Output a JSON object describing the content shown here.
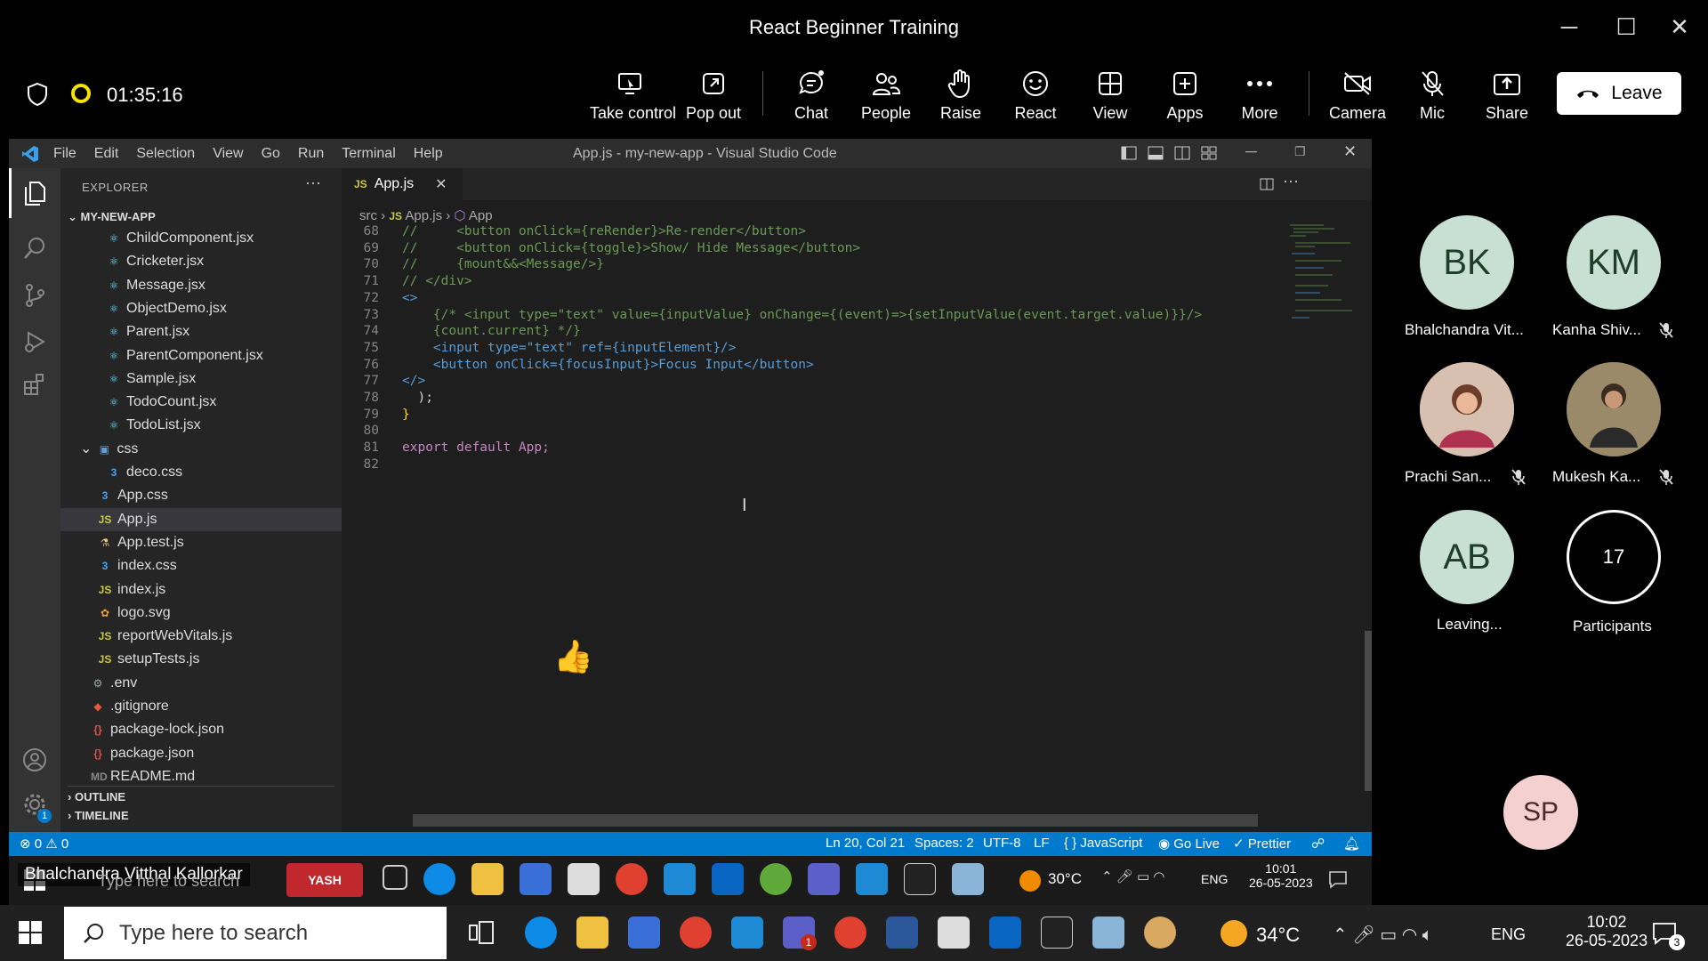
{
  "teams": {
    "window_title": "React Beginner Training",
    "timer": "01:35:16",
    "toolbar": [
      {
        "label": "Take control",
        "icon": "take-control-icon"
      },
      {
        "label": "Pop out",
        "icon": "pop-out-icon"
      },
      {
        "label": "Chat",
        "icon": "chat-icon"
      },
      {
        "label": "People",
        "icon": "people-icon"
      },
      {
        "label": "Raise",
        "icon": "raise-hand-icon"
      },
      {
        "label": "React",
        "icon": "react-smiley-icon"
      },
      {
        "label": "View",
        "icon": "view-grid-icon"
      },
      {
        "label": "Apps",
        "icon": "apps-plus-icon"
      },
      {
        "label": "More",
        "icon": "more-ellipsis-icon"
      },
      {
        "label": "Camera",
        "icon": "camera-off-icon"
      },
      {
        "label": "Mic",
        "icon": "mic-off-icon"
      },
      {
        "label": "Share",
        "icon": "share-icon"
      }
    ],
    "leave_label": "Leave",
    "reaction_emoji": "👍",
    "participants": [
      {
        "initials": "BK",
        "name": "Bhalchandra Vit...",
        "muted": false
      },
      {
        "initials": "KM",
        "name": "Kanha Shiv...",
        "muted": true
      },
      {
        "initials": "",
        "name": "Prachi San...",
        "muted": true
      },
      {
        "initials": "",
        "name": "Mukesh Ka...",
        "muted": true
      },
      {
        "initials": "AB",
        "name": "Leaving...",
        "muted": false
      },
      {
        "initials": "17",
        "name": "Participants",
        "muted": false
      }
    ],
    "self_initials": "SP",
    "presenter": "Bhalchandra Vitthal Kallorkar"
  },
  "vscode": {
    "menu": [
      "File",
      "Edit",
      "Selection",
      "View",
      "Go",
      "Run",
      "Terminal",
      "Help"
    ],
    "window_title": "App.js - my-new-app - Visual Studio Code",
    "explorer_title": "EXPLORER",
    "explorer_more": "···",
    "root_folder": "MY-NEW-APP",
    "tree": [
      {
        "name": "ChildComponent.jsx",
        "type": "jsx",
        "indent": 2
      },
      {
        "name": "Cricketer.jsx",
        "type": "jsx",
        "indent": 2
      },
      {
        "name": "Message.jsx",
        "type": "jsx",
        "indent": 2
      },
      {
        "name": "ObjectDemo.jsx",
        "type": "jsx",
        "indent": 2
      },
      {
        "name": "Parent.jsx",
        "type": "jsx",
        "indent": 2
      },
      {
        "name": "ParentComponent.jsx",
        "type": "jsx",
        "indent": 2
      },
      {
        "name": "Sample.jsx",
        "type": "jsx",
        "indent": 2
      },
      {
        "name": "TodoCount.jsx",
        "type": "jsx",
        "indent": 2
      },
      {
        "name": "TodoList.jsx",
        "type": "jsx",
        "indent": 2
      },
      {
        "name": "css",
        "type": "folder",
        "indent": 1
      },
      {
        "name": "deco.css",
        "type": "css",
        "indent": 2
      },
      {
        "name": "App.css",
        "type": "css",
        "indent": 1
      },
      {
        "name": "App.js",
        "type": "js",
        "indent": 1,
        "selected": true
      },
      {
        "name": "App.test.js",
        "type": "test",
        "indent": 1
      },
      {
        "name": "index.css",
        "type": "css",
        "indent": 1
      },
      {
        "name": "index.js",
        "type": "js",
        "indent": 1
      },
      {
        "name": "logo.svg",
        "type": "svg",
        "indent": 1
      },
      {
        "name": "reportWebVitals.js",
        "type": "js",
        "indent": 1
      },
      {
        "name": "setupTests.js",
        "type": "js",
        "indent": 1
      },
      {
        "name": ".env",
        "type": "gear",
        "indent": 0
      },
      {
        "name": ".gitignore",
        "type": "git",
        "indent": 0
      },
      {
        "name": "package-lock.json",
        "type": "json",
        "indent": 0
      },
      {
        "name": "package.json",
        "type": "json",
        "indent": 0
      },
      {
        "name": "README.md",
        "type": "md",
        "indent": 0
      }
    ],
    "outline_label": "OUTLINE",
    "timeline_label": "TIMELINE",
    "tab_label": "App.js",
    "tab_lang": "JS",
    "breadcrumb": {
      "src": "src",
      "file": "App.js",
      "symbol": "App"
    },
    "code": [
      {
        "n": "68",
        "t": "//     <button onClick={reRender}>Re-render</button>",
        "k": "com"
      },
      {
        "n": "69",
        "t": "//     <button onClick={toggle}>Show/ Hide Message</button>",
        "k": "com"
      },
      {
        "n": "70",
        "t": "//     {mount&&<Message/>}",
        "k": "com"
      },
      {
        "n": "71",
        "t": "// </div>",
        "k": "com"
      },
      {
        "n": "72",
        "t": "<>",
        "k": "tag"
      },
      {
        "n": "73",
        "t": "    {/* <input type=\"text\" value={inputValue} onChange={(event)=>{setInputValue(event.target.value)}}/>",
        "k": "com"
      },
      {
        "n": "74",
        "t": "    {count.current} */}",
        "k": "com"
      },
      {
        "n": "75",
        "t": "    <input type=\"text\" ref={inputElement}/>",
        "k": "input"
      },
      {
        "n": "76",
        "t": "    <button onClick={focusInput}>Focus Input</button>",
        "k": "button"
      },
      {
        "n": "77",
        "t": "</>",
        "k": "tag"
      },
      {
        "n": "78",
        "t": "  );",
        "k": "plain"
      },
      {
        "n": "79",
        "t": "}",
        "k": "brace"
      },
      {
        "n": "80",
        "t": "",
        "k": "plain"
      },
      {
        "n": "81",
        "t": "export default App;",
        "k": "export"
      },
      {
        "n": "82",
        "t": "",
        "k": "plain"
      }
    ],
    "status": {
      "problems": "⊗ 0 ⚠ 0",
      "position": "Ln 20, Col 21",
      "spaces": "Spaces: 2",
      "encoding": "UTF-8",
      "eol": "LF",
      "language": "{ } JavaScript",
      "golive": "Go Live",
      "prettier": "Prettier"
    },
    "activity_badge": "1"
  },
  "inner_taskbar": {
    "search_placeholder": "Type here to search",
    "weather": "30°C",
    "lang": "ENG",
    "time": "10:01",
    "date": "26-05-2023"
  },
  "taskbar": {
    "search_placeholder": "Type here to search",
    "weather": "34°C",
    "lang": "ENG",
    "time": "10:02",
    "date": "26-05-2023",
    "notifications": "3",
    "teams_badge": "1"
  }
}
